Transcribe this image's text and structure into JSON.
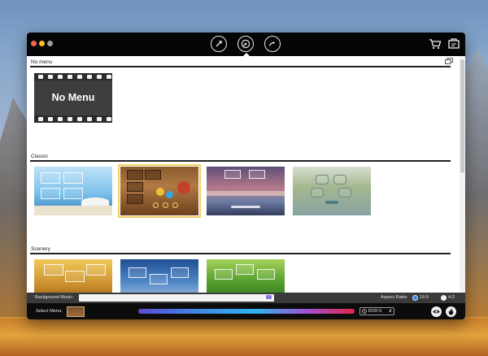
{
  "toolbar": {
    "tabs": [
      {
        "icon": "sync-icon"
      },
      {
        "icon": "disc-icon",
        "active": true
      },
      {
        "icon": "share-icon"
      }
    ],
    "right_icons": [
      "cart-icon",
      "register-icon"
    ]
  },
  "sections": [
    {
      "title": "No menu",
      "items": [
        {
          "label": "No Menu"
        }
      ]
    },
    {
      "title": "Classic",
      "items": 4,
      "selected_index": 1
    },
    {
      "title": "Scenery",
      "items": 3
    }
  ],
  "background_music": {
    "label": "Background Music:",
    "value": ""
  },
  "aspect_ratio": {
    "label": "Aspect Ratio:",
    "options": [
      "16:9",
      "4:3"
    ],
    "selected": "16:9"
  },
  "select_menu": {
    "label": "Select Menu:"
  },
  "disc": {
    "selected": "DVD-5"
  },
  "colors": {
    "titlebar": "#050505",
    "selected_outline": "#f0d060",
    "radio_on": "#2f86e8"
  }
}
